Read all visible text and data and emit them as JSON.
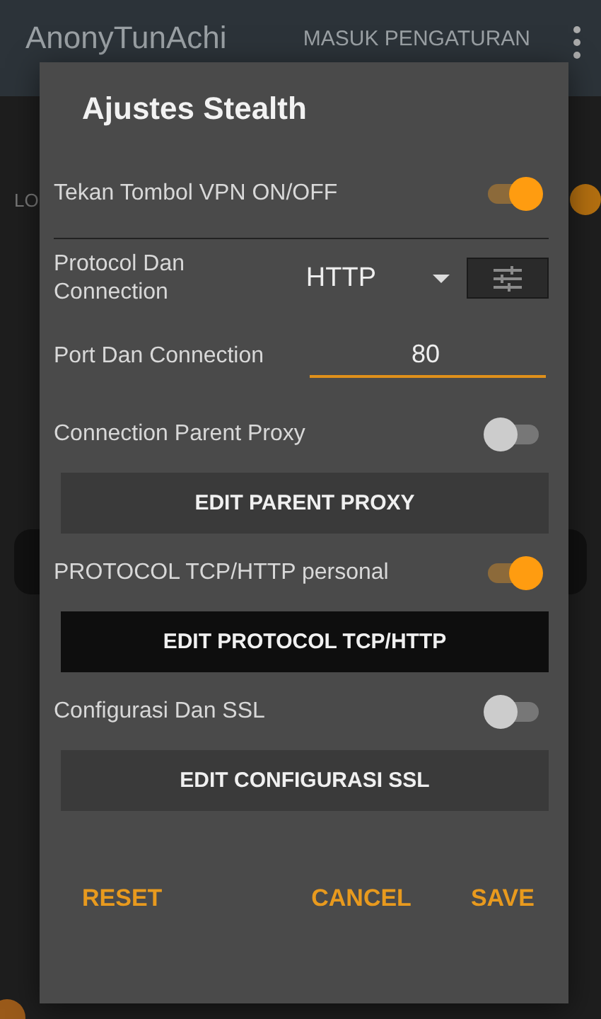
{
  "app_bar": {
    "title": "AnonyTunAchi",
    "action": "MASUK PENGATURAN"
  },
  "background": {
    "tab_label": "LO",
    "switch": {
      "on": true
    }
  },
  "dialog": {
    "title": "Ajustes Stealth",
    "items": [
      {
        "kind": "toggle",
        "label": "Tekan Tombol VPN ON/OFF",
        "on": true
      },
      {
        "kind": "select",
        "label": "Protocol Dan Connection",
        "value": "HTTP"
      },
      {
        "kind": "field",
        "label": "Port Dan Connection",
        "value": "80"
      },
      {
        "kind": "toggle",
        "label": "Connection Parent Proxy",
        "on": false
      },
      {
        "kind": "button",
        "label": "EDIT PARENT PROXY",
        "disabled": true
      },
      {
        "kind": "toggle",
        "label": "PROTOCOL TCP/HTTP personal",
        "on": true
      },
      {
        "kind": "button",
        "label": "EDIT PROTOCOL TCP/HTTP",
        "disabled": false
      },
      {
        "kind": "toggle",
        "label": "Configurasi Dan SSL",
        "on": false
      },
      {
        "kind": "button",
        "label": "EDIT CONFIGURASI SSL",
        "disabled": true
      }
    ],
    "actions": {
      "left": "RESET",
      "right": [
        "CANCEL",
        "SAVE"
      ]
    }
  }
}
